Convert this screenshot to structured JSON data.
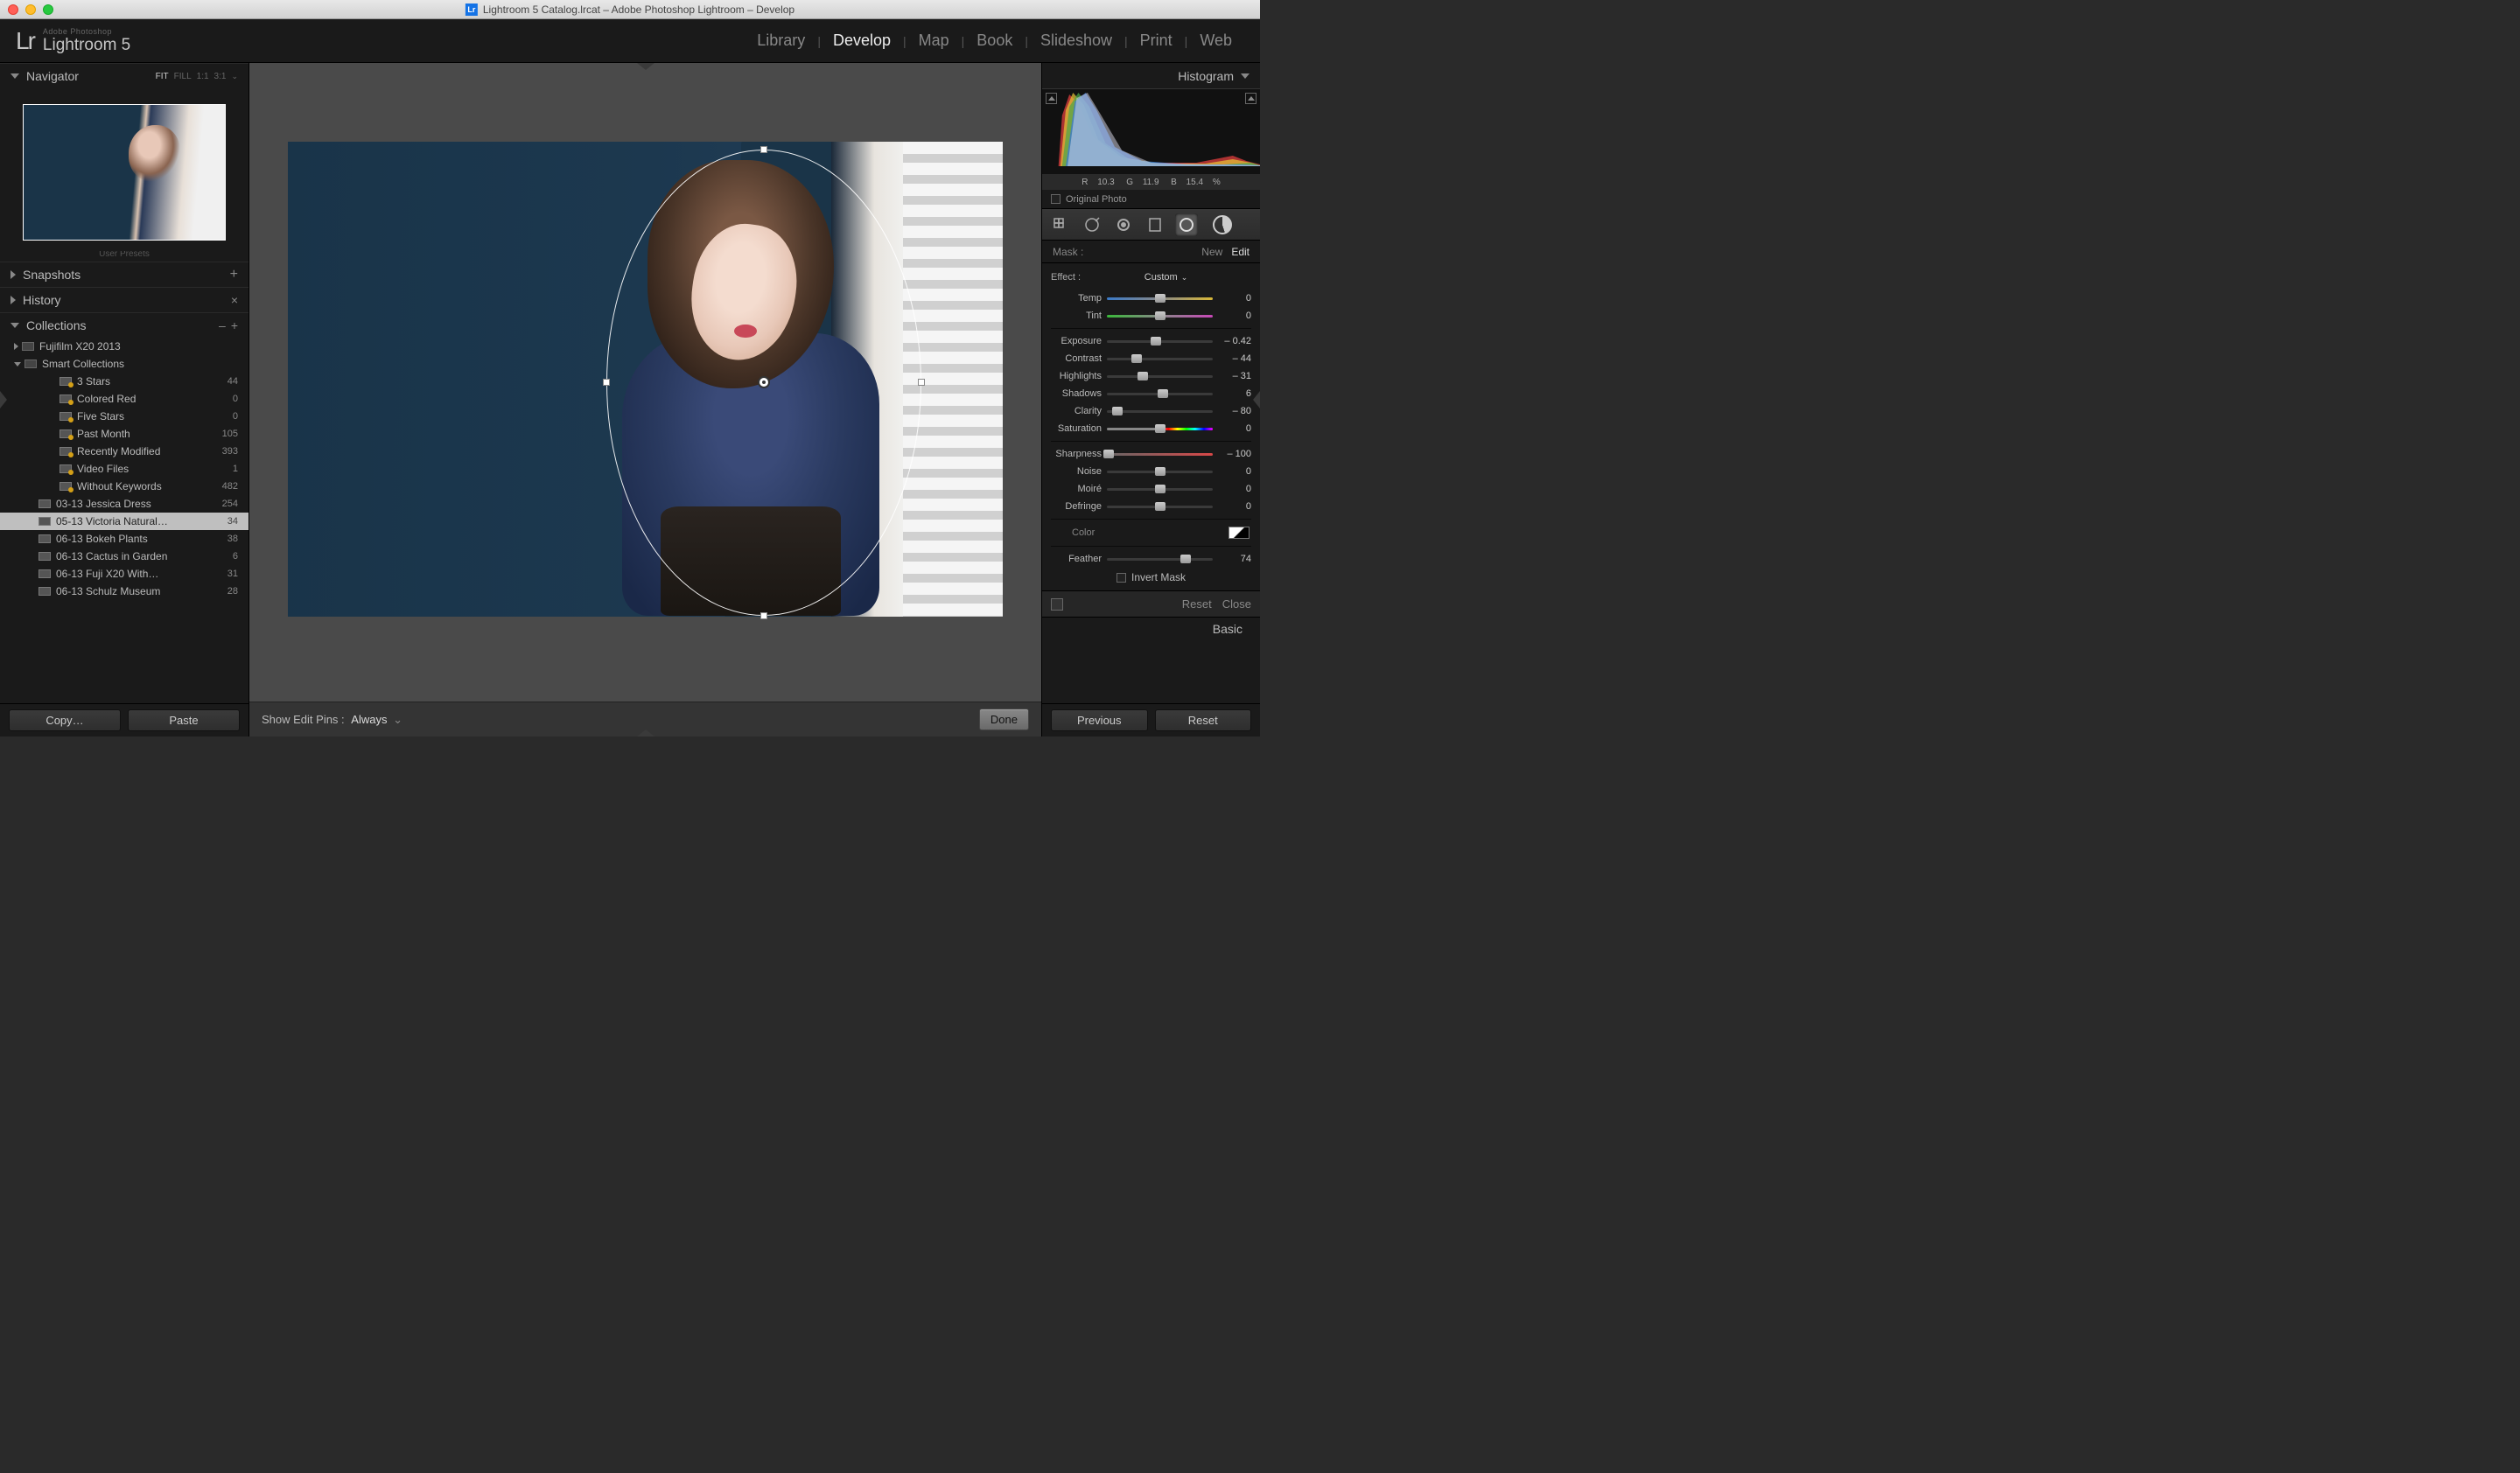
{
  "window": {
    "title": "Lightroom 5 Catalog.lrcat – Adobe Photoshop Lightroom – Develop"
  },
  "brand": {
    "glyph": "Lr",
    "small": "Adobe Photoshop",
    "big": "Lightroom 5"
  },
  "modules": [
    "Library",
    "Develop",
    "Map",
    "Book",
    "Slideshow",
    "Print",
    "Web"
  ],
  "active_module": "Develop",
  "navigator": {
    "title": "Navigator",
    "zoom_options": [
      "FIT",
      "FILL",
      "1:1",
      "3:1"
    ],
    "zoom_active": "FIT"
  },
  "left_panels": {
    "user_presets": "User Presets",
    "snapshots": "Snapshots",
    "history": "History",
    "collections": "Collections"
  },
  "collections": [
    {
      "depth": 0,
      "open": false,
      "type": "group",
      "label": "Fujifilm X20 2013",
      "count": ""
    },
    {
      "depth": 0,
      "open": true,
      "type": "group",
      "label": "Smart Collections",
      "count": ""
    },
    {
      "depth": 1,
      "type": "smart",
      "label": "3 Stars",
      "count": "44"
    },
    {
      "depth": 1,
      "type": "smart",
      "label": "Colored Red",
      "count": "0"
    },
    {
      "depth": 1,
      "type": "smart",
      "label": "Five Stars",
      "count": "0"
    },
    {
      "depth": 1,
      "type": "smart",
      "label": "Past Month",
      "count": "105"
    },
    {
      "depth": 1,
      "type": "smart",
      "label": "Recently Modified",
      "count": "393"
    },
    {
      "depth": 1,
      "type": "smart",
      "label": "Video Files",
      "count": "1"
    },
    {
      "depth": 1,
      "type": "smart",
      "label": "Without Keywords",
      "count": "482"
    },
    {
      "depth": 0,
      "type": "coll",
      "label": "03-13 Jessica Dress",
      "count": "254"
    },
    {
      "depth": 0,
      "type": "coll",
      "label": "05-13 Victoria Natural…",
      "count": "34",
      "selected": true
    },
    {
      "depth": 0,
      "type": "coll",
      "label": "06-13 Bokeh Plants",
      "count": "38"
    },
    {
      "depth": 0,
      "type": "coll",
      "label": "06-13 Cactus in Garden",
      "count": "6"
    },
    {
      "depth": 0,
      "type": "coll",
      "label": "06-13 Fuji X20 With…",
      "count": "31"
    },
    {
      "depth": 0,
      "type": "coll",
      "label": "06-13 Schulz Museum",
      "count": "28"
    }
  ],
  "left_buttons": {
    "copy": "Copy…",
    "paste": "Paste"
  },
  "center_bottom": {
    "show_pins_label": "Show Edit Pins :",
    "show_pins_value": "Always",
    "done": "Done"
  },
  "histogram": {
    "title": "Histogram",
    "rgb": {
      "r_label": "R",
      "r": "10.3",
      "g_label": "G",
      "g": "11.9",
      "b_label": "B",
      "b": "15.4",
      "pct": "%"
    },
    "original": "Original Photo"
  },
  "mask": {
    "label": "Mask :",
    "new": "New",
    "edit": "Edit"
  },
  "effect": {
    "label": "Effect :",
    "value": "Custom"
  },
  "sliders": {
    "groups": [
      [
        {
          "k": "Temp",
          "v": "0",
          "pos": 50,
          "track": "temp"
        },
        {
          "k": "Tint",
          "v": "0",
          "pos": 50,
          "track": "tint"
        }
      ],
      [
        {
          "k": "Exposure",
          "v": "– 0.42",
          "pos": 46
        },
        {
          "k": "Contrast",
          "v": "– 44",
          "pos": 28
        },
        {
          "k": "Highlights",
          "v": "– 31",
          "pos": 34
        },
        {
          "k": "Shadows",
          "v": "6",
          "pos": 53
        },
        {
          "k": "Clarity",
          "v": "– 80",
          "pos": 10
        },
        {
          "k": "Saturation",
          "v": "0",
          "pos": 50,
          "track": "sat"
        }
      ],
      [
        {
          "k": "Sharpness",
          "v": "– 100",
          "pos": 2,
          "track": "sharp"
        },
        {
          "k": "Noise",
          "v": "0",
          "pos": 50
        },
        {
          "k": "Moiré",
          "v": "0",
          "pos": 50
        },
        {
          "k": "Defringe",
          "v": "0",
          "pos": 50
        }
      ]
    ],
    "color_label": "Color",
    "feather": {
      "k": "Feather",
      "v": "74",
      "pos": 74
    },
    "invert": "Invert Mask"
  },
  "switch_row": {
    "reset": "Reset",
    "close": "Close"
  },
  "basic": "Basic",
  "right_buttons": {
    "previous": "Previous",
    "reset": "Reset"
  }
}
